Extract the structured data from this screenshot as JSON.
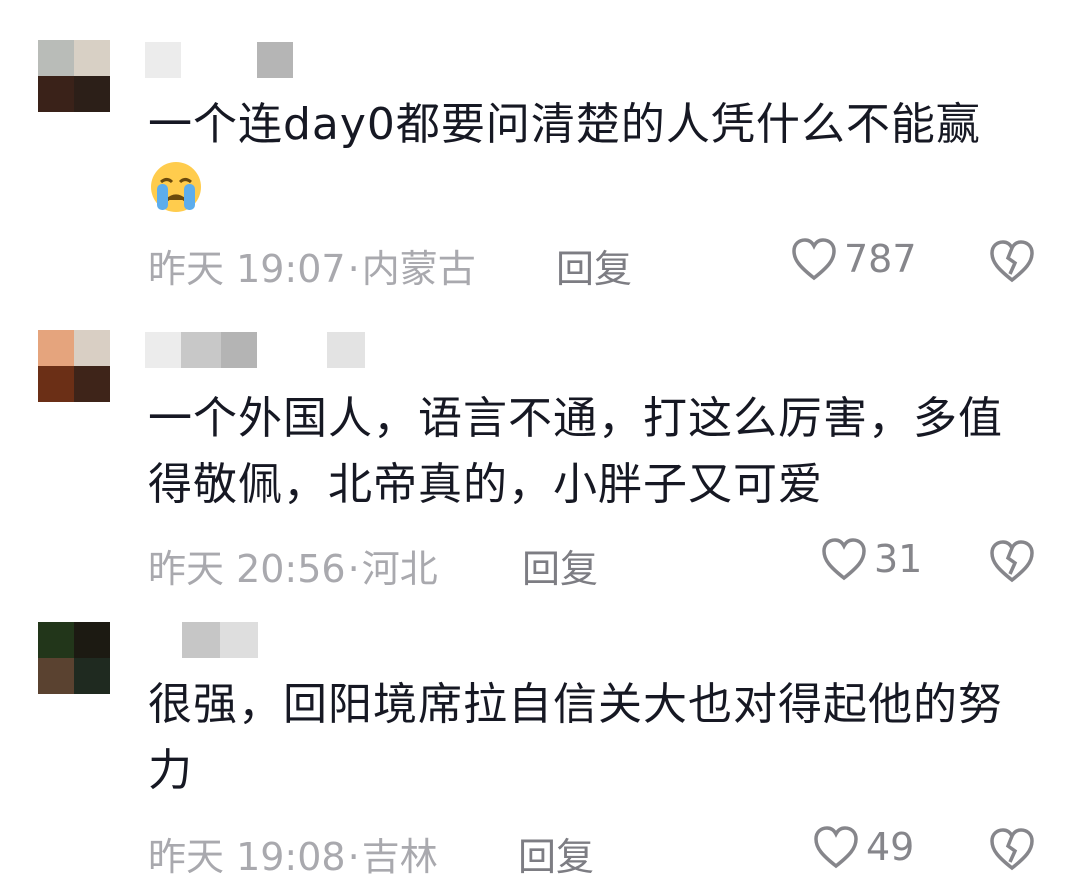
{
  "comments": [
    {
      "text": "一个连day0都要问清楚的人凭什么不能赢",
      "emoji": "loudly-crying-face",
      "time": "昨天 19:07",
      "location": "内蒙古",
      "reply_label": "回复",
      "likes": "787"
    },
    {
      "text": "一个外国人，语言不通，打这么厉害，多值得敬佩，北帝真的，小胖子又可爱",
      "time": "昨天 20:56",
      "location": "河北",
      "reply_label": "回复",
      "likes": "31"
    },
    {
      "text": "很强，回阳境席拉自信关大也对得起他的努力",
      "time": "昨天 19:08",
      "location": "吉林",
      "reply_label": "回复",
      "likes": "49"
    }
  ],
  "separator": "·",
  "icons": {
    "like": "heart-outline-icon",
    "dislike": "broken-heart-icon"
  },
  "colors": {
    "text": "#161823",
    "meta": "#a9a9ae",
    "icon": "#86868b",
    "background": "#ffffff"
  }
}
